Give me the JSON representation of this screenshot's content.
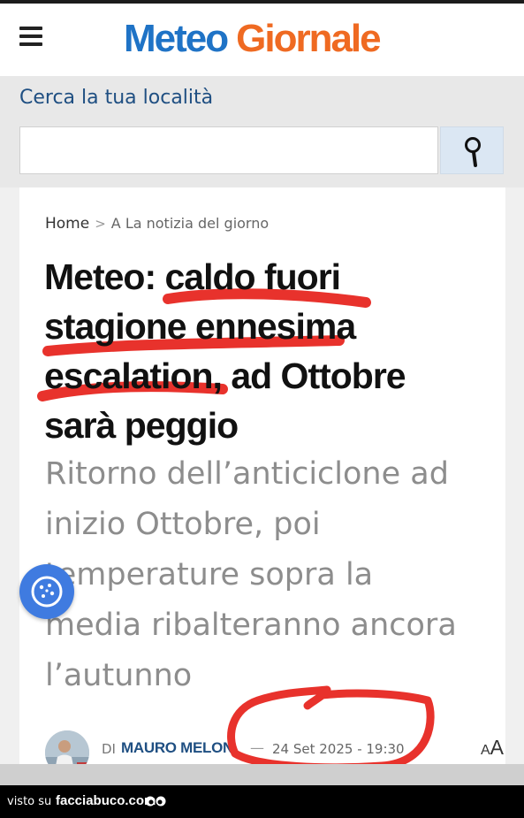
{
  "header": {
    "logo_part1": "Meteo",
    "logo_part2": "Giornale",
    "menu_icon": "hamburger-menu-icon"
  },
  "search": {
    "label": "Cerca la tua località",
    "value": "",
    "placeholder": "",
    "button_icon": "search-icon"
  },
  "article": {
    "breadcrumb": {
      "home": "Home",
      "separator": ">",
      "current": "A La notizia del giorno"
    },
    "title_lines": [
      "Meteo: caldo fuori",
      "stagione ennesima",
      "escalation, ad Ottobre",
      "sarà peggio"
    ],
    "subtitle_lines": [
      "Ritorno dell’anticiclone ad",
      "inizio Ottobre, poi",
      "temperature sopra la",
      "media ribalteranno ancora",
      "l’autunno"
    ],
    "byline": {
      "prefix": "DI",
      "author": "MAURO MELON",
      "dash": "—",
      "date": "24 Set 2025 - 19:30",
      "text_size_big": "A",
      "text_size_small": "A"
    }
  },
  "footer": {
    "visto_su": "visto su",
    "site": "facciabuco.com"
  },
  "colors": {
    "logo_blue": "#1f73c6",
    "logo_orange": "#ef6a22",
    "annotation_red": "#e8322c",
    "fab_blue": "#3f7be0"
  }
}
